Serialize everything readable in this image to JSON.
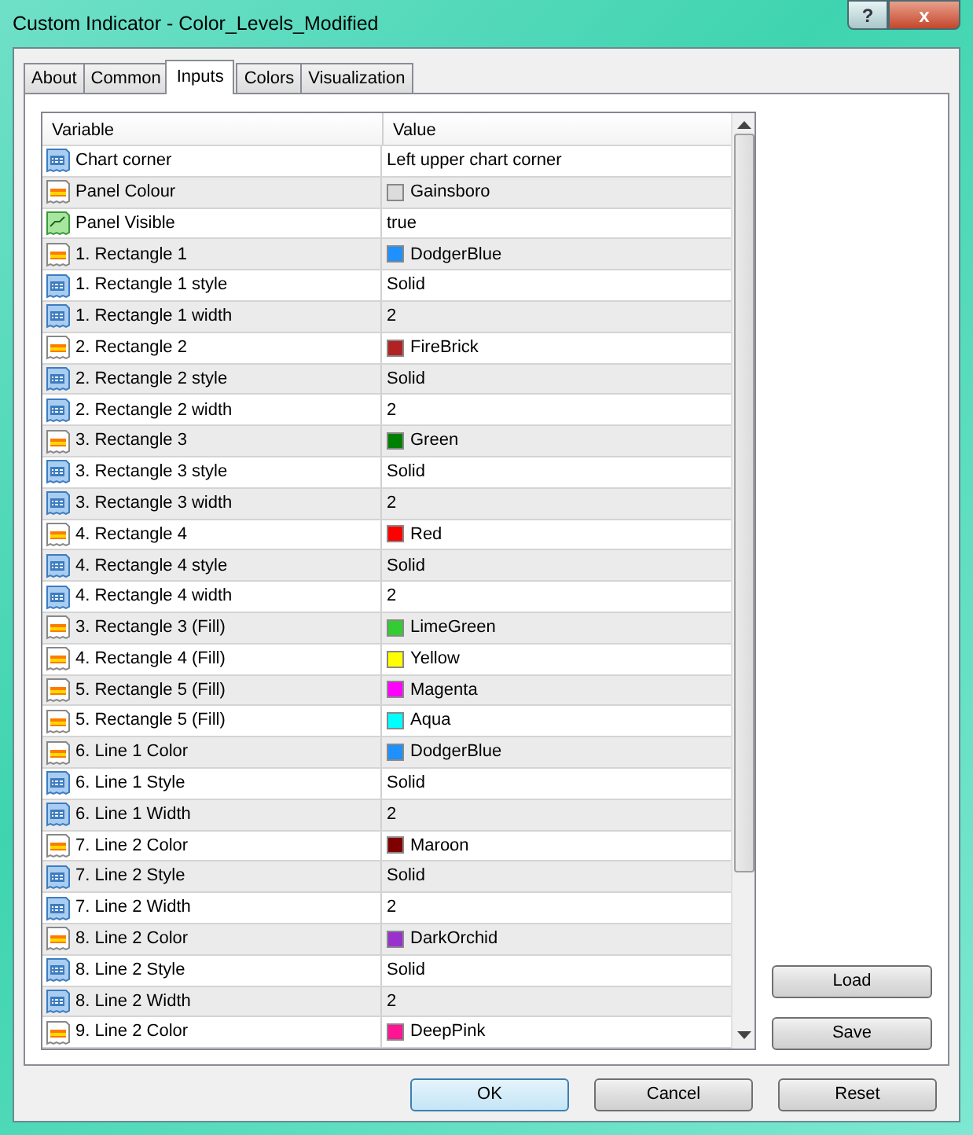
{
  "window": {
    "title": "Custom Indicator - Color_Levels_Modified",
    "controls": [
      "?",
      "x"
    ]
  },
  "tabs": [
    {
      "label": "About",
      "selected": false
    },
    {
      "label": "Common",
      "selected": false
    },
    {
      "label": "Inputs",
      "selected": true
    },
    {
      "label": "Colors",
      "selected": false
    },
    {
      "label": "Visualization",
      "selected": false
    }
  ],
  "table": {
    "columns": [
      "Variable",
      "Value"
    ],
    "rows": [
      {
        "kind": "int",
        "variable": "Chart corner",
        "value": "Left upper chart corner"
      },
      {
        "kind": "color",
        "variable": "Panel Colour",
        "value": "Gainsboro",
        "color": "#dcdcdc"
      },
      {
        "kind": "bool",
        "variable": "Panel Visible",
        "value": "true"
      },
      {
        "kind": "color",
        "variable": "1. Rectangle 1",
        "value": "DodgerBlue",
        "color": "#1e90ff"
      },
      {
        "kind": "int",
        "variable": "1. Rectangle 1 style",
        "value": "Solid"
      },
      {
        "kind": "int",
        "variable": "1. Rectangle 1 width",
        "value": "2"
      },
      {
        "kind": "color",
        "variable": "2. Rectangle 2",
        "value": "FireBrick",
        "color": "#b22222"
      },
      {
        "kind": "int",
        "variable": "2. Rectangle 2 style",
        "value": "Solid"
      },
      {
        "kind": "int",
        "variable": "2. Rectangle 2 width",
        "value": "2"
      },
      {
        "kind": "color",
        "variable": "3. Rectangle 3",
        "value": "Green",
        "color": "#008000"
      },
      {
        "kind": "int",
        "variable": "3. Rectangle 3 style",
        "value": "Solid"
      },
      {
        "kind": "int",
        "variable": "3. Rectangle 3 width",
        "value": "2"
      },
      {
        "kind": "color",
        "variable": "4. Rectangle 4",
        "value": "Red",
        "color": "#ff0000"
      },
      {
        "kind": "int",
        "variable": "4. Rectangle 4 style",
        "value": "Solid"
      },
      {
        "kind": "int",
        "variable": "4. Rectangle 4 width",
        "value": "2"
      },
      {
        "kind": "color",
        "variable": "3. Rectangle 3 (Fill)",
        "value": "LimeGreen",
        "color": "#32cd32"
      },
      {
        "kind": "color",
        "variable": "4. Rectangle 4 (Fill)",
        "value": "Yellow",
        "color": "#ffff00"
      },
      {
        "kind": "color",
        "variable": "5. Rectangle 5 (Fill)",
        "value": "Magenta",
        "color": "#ff00ff"
      },
      {
        "kind": "color",
        "variable": "5. Rectangle 5 (Fill)",
        "value": "Aqua",
        "color": "#00ffff"
      },
      {
        "kind": "color",
        "variable": "6. Line 1 Color",
        "value": "DodgerBlue",
        "color": "#1e90ff"
      },
      {
        "kind": "int",
        "variable": "6. Line 1 Style",
        "value": "Solid"
      },
      {
        "kind": "int",
        "variable": "6. Line 1 Width",
        "value": "2"
      },
      {
        "kind": "color",
        "variable": "7. Line 2 Color",
        "value": "Maroon",
        "color": "#800000"
      },
      {
        "kind": "int",
        "variable": "7. Line 2 Style",
        "value": "Solid"
      },
      {
        "kind": "int",
        "variable": "7. Line 2 Width",
        "value": "2"
      },
      {
        "kind": "color",
        "variable": "8. Line 2 Color",
        "value": "DarkOrchid",
        "color": "#9932cc"
      },
      {
        "kind": "int",
        "variable": "8. Line 2 Style",
        "value": "Solid"
      },
      {
        "kind": "int",
        "variable": "8. Line 2 Width",
        "value": "2"
      },
      {
        "kind": "color",
        "variable": "9. Line 2 Color",
        "value": "DeepPink",
        "color": "#ff1493"
      }
    ]
  },
  "side_buttons": [
    "Load",
    "Save"
  ],
  "buttons": [
    {
      "label": "OK",
      "default": true
    },
    {
      "label": "Cancel",
      "default": false
    },
    {
      "label": "Reset",
      "default": false
    }
  ]
}
